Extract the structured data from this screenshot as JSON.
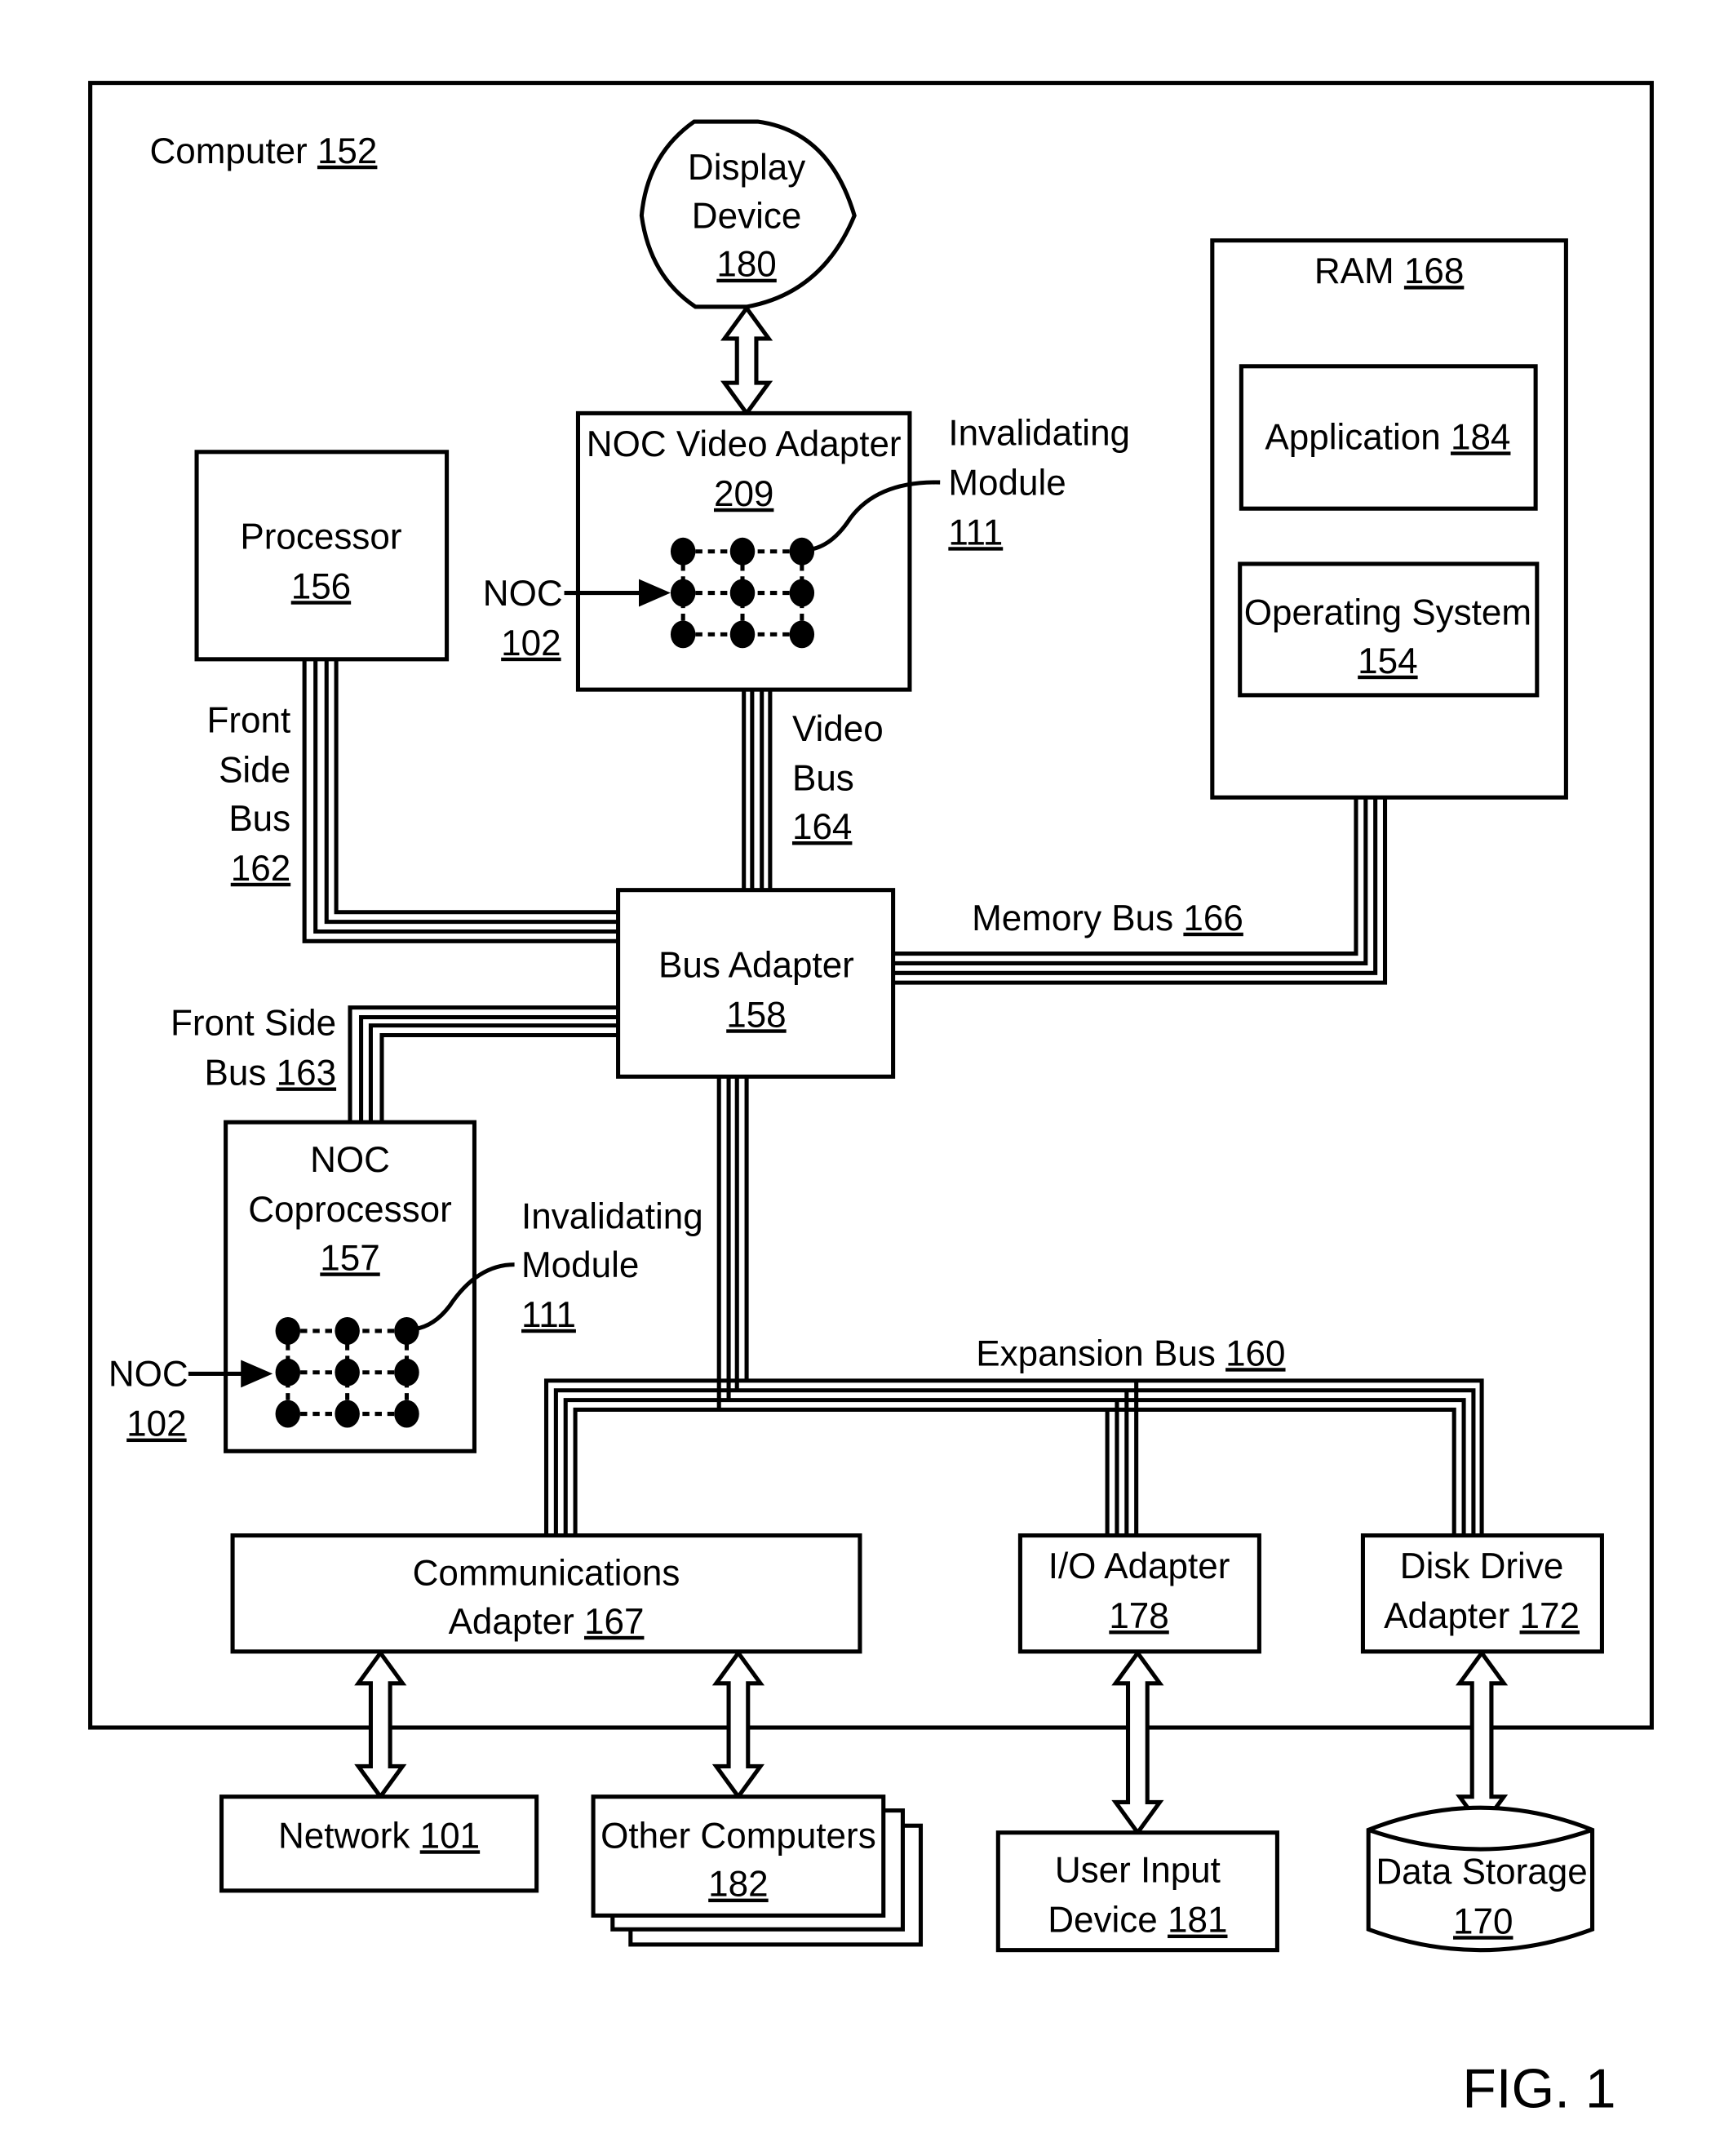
{
  "figure_label": "FIG. 1",
  "computer": {
    "name": "Computer",
    "ref": "152"
  },
  "display_device": {
    "lines": [
      "Display",
      "Device"
    ],
    "ref": "180"
  },
  "noc_video_adapter": {
    "name": "NOC Video Adapter",
    "ref": "209"
  },
  "processor": {
    "name": "Processor",
    "ref": "156"
  },
  "ram": {
    "name": "RAM",
    "ref": "168"
  },
  "application": {
    "name": "Application",
    "ref": "184"
  },
  "operating_system": {
    "name": "Operating System",
    "ref": "154"
  },
  "invalidating_module_top": {
    "lines": [
      "Invalidating",
      "Module"
    ],
    "ref": "111"
  },
  "invalidating_module_bottom": {
    "lines": [
      "Invalidating",
      "Module"
    ],
    "ref": "111"
  },
  "noc_top": {
    "name": "NOC",
    "ref": "102"
  },
  "noc_bottom": {
    "name": "NOC",
    "ref": "102"
  },
  "front_side_bus_162": {
    "lines": [
      "Front",
      "Side",
      "Bus"
    ],
    "ref": "162"
  },
  "video_bus": {
    "lines": [
      "Video",
      "Bus"
    ],
    "ref": "164"
  },
  "memory_bus": {
    "name": "Memory Bus",
    "ref": "166"
  },
  "bus_adapter": {
    "name": "Bus Adapter",
    "ref": "158"
  },
  "front_side_bus_163": {
    "lines": [
      "Front Side",
      "Bus"
    ],
    "ref": "163"
  },
  "noc_coprocessor": {
    "lines": [
      "NOC",
      "Coprocessor"
    ],
    "ref": "157"
  },
  "expansion_bus": {
    "name": "Expansion Bus",
    "ref": "160"
  },
  "communications_adapter": {
    "lines": [
      "Communications",
      "Adapter"
    ],
    "ref": "167"
  },
  "io_adapter": {
    "name": "I/O Adapter",
    "ref": "178"
  },
  "disk_drive_adapter": {
    "lines": [
      "Disk Drive",
      "Adapter"
    ],
    "ref": "172"
  },
  "network": {
    "name": "Network",
    "ref": "101"
  },
  "other_computers": {
    "name": "Other Computers",
    "ref": "182"
  },
  "user_input_device": {
    "lines": [
      "User Input",
      "Device"
    ],
    "ref": "181"
  },
  "data_storage": {
    "name": "Data Storage",
    "ref": "170"
  }
}
